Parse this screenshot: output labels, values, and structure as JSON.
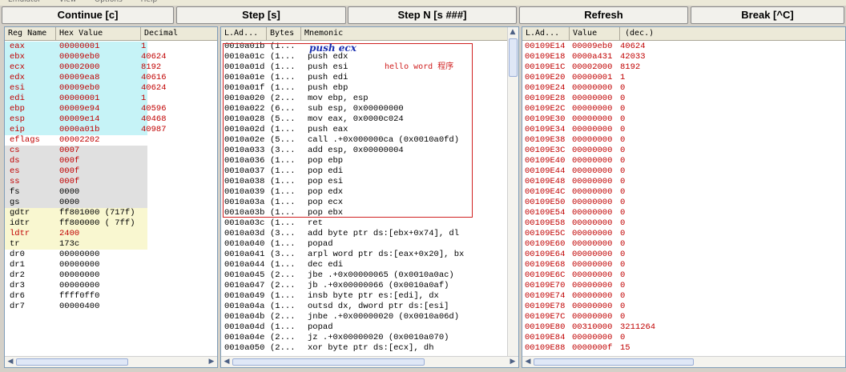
{
  "menubar": [
    "Emulator",
    "View",
    "Options",
    "Help"
  ],
  "toolbar": {
    "continue": "Continue [c]",
    "step": "Step [s]",
    "stepn": "Step N [s ###]",
    "refresh": "Refresh",
    "break": "Break [^C]"
  },
  "regs": {
    "headers": [
      "Reg Name",
      "Hex Value",
      "Decimal"
    ],
    "rows": [
      {
        "name": "eax",
        "hex": "00000001",
        "dec": "1",
        "grp": "reg",
        "color": "red"
      },
      {
        "name": "ebx",
        "hex": "00009eb0",
        "dec": "40624",
        "grp": "reg",
        "color": "red"
      },
      {
        "name": "ecx",
        "hex": "00002000",
        "dec": "8192",
        "grp": "reg",
        "color": "red"
      },
      {
        "name": "edx",
        "hex": "00009ea8",
        "dec": "40616",
        "grp": "reg",
        "color": "red"
      },
      {
        "name": "esi",
        "hex": "00009eb0",
        "dec": "40624",
        "grp": "reg",
        "color": "red"
      },
      {
        "name": "edi",
        "hex": "00000001",
        "dec": "1",
        "grp": "reg",
        "color": "red"
      },
      {
        "name": "ebp",
        "hex": "00009e94",
        "dec": "40596",
        "grp": "reg",
        "color": "red"
      },
      {
        "name": "esp",
        "hex": "00009e14",
        "dec": "40468",
        "grp": "reg",
        "color": "red"
      },
      {
        "name": "eip",
        "hex": "0000a01b",
        "dec": "40987",
        "grp": "reg",
        "color": "red"
      },
      {
        "name": "eflags",
        "hex": "00002202",
        "dec": "",
        "grp": "dr",
        "color": "red"
      },
      {
        "name": "cs",
        "hex": "0007",
        "dec": "",
        "grp": "seg",
        "color": "red"
      },
      {
        "name": "ds",
        "hex": "000f",
        "dec": "",
        "grp": "seg",
        "color": "red"
      },
      {
        "name": "es",
        "hex": "000f",
        "dec": "",
        "grp": "seg",
        "color": "red"
      },
      {
        "name": "ss",
        "hex": "000f",
        "dec": "",
        "grp": "seg",
        "color": "red"
      },
      {
        "name": "fs",
        "hex": "0000",
        "dec": "",
        "grp": "seg",
        "color": "black"
      },
      {
        "name": "gs",
        "hex": "0000",
        "dec": "",
        "grp": "seg",
        "color": "black"
      },
      {
        "name": "gdtr",
        "hex": "ff801000 (717f)",
        "dec": "",
        "grp": "desc",
        "color": "black"
      },
      {
        "name": "idtr",
        "hex": "ff800000 ( 7ff)",
        "dec": "",
        "grp": "desc",
        "color": "black"
      },
      {
        "name": "ldtr",
        "hex": "2400",
        "dec": "",
        "grp": "desc",
        "color": "red"
      },
      {
        "name": "tr",
        "hex": "173c",
        "dec": "",
        "grp": "desc",
        "color": "black"
      },
      {
        "name": "dr0",
        "hex": "00000000",
        "dec": "",
        "grp": "dr",
        "color": "black"
      },
      {
        "name": "dr1",
        "hex": "00000000",
        "dec": "",
        "grp": "dr",
        "color": "black"
      },
      {
        "name": "dr2",
        "hex": "00000000",
        "dec": "",
        "grp": "dr",
        "color": "black"
      },
      {
        "name": "dr3",
        "hex": "00000000",
        "dec": "",
        "grp": "dr",
        "color": "black"
      },
      {
        "name": "dr6",
        "hex": "ffff0ff0",
        "dec": "",
        "grp": "dr",
        "color": "black"
      },
      {
        "name": "dr7",
        "hex": "00000400",
        "dec": "",
        "grp": "dr",
        "color": "black"
      }
    ]
  },
  "disasm": {
    "headers": [
      "L.Ad...",
      "Bytes",
      "Mnemonic"
    ],
    "rows": [
      {
        "addr": "0010a01b",
        "bytes": "(1...",
        "mn": ""
      },
      {
        "addr": "0010a01c",
        "bytes": "(1...",
        "mn": "push edx"
      },
      {
        "addr": "0010a01d",
        "bytes": "(1...",
        "mn": "push esi"
      },
      {
        "addr": "0010a01e",
        "bytes": "(1...",
        "mn": "push edi"
      },
      {
        "addr": "0010a01f",
        "bytes": "(1...",
        "mn": "push ebp"
      },
      {
        "addr": "0010a020",
        "bytes": "(2...",
        "mn": "mov ebp, esp"
      },
      {
        "addr": "0010a022",
        "bytes": "(6...",
        "mn": "sub esp, 0x00000000"
      },
      {
        "addr": "0010a028",
        "bytes": "(5...",
        "mn": "mov eax, 0x0000c024"
      },
      {
        "addr": "0010a02d",
        "bytes": "(1...",
        "mn": "push eax"
      },
      {
        "addr": "0010a02e",
        "bytes": "(5...",
        "mn": "call .+0x000000ca  (0x0010a0fd)"
      },
      {
        "addr": "0010a033",
        "bytes": "(3...",
        "mn": "add esp, 0x00000004"
      },
      {
        "addr": "0010a036",
        "bytes": "(1...",
        "mn": "pop ebp"
      },
      {
        "addr": "0010a037",
        "bytes": "(1...",
        "mn": "pop edi"
      },
      {
        "addr": "0010a038",
        "bytes": "(1...",
        "mn": "pop esi"
      },
      {
        "addr": "0010a039",
        "bytes": "(1...",
        "mn": "pop edx"
      },
      {
        "addr": "0010a03a",
        "bytes": "(1...",
        "mn": "pop ecx"
      },
      {
        "addr": "0010a03b",
        "bytes": "(1...",
        "mn": "pop ebx"
      },
      {
        "addr": "0010a03c",
        "bytes": "(1...",
        "mn": "ret"
      },
      {
        "addr": "0010a03d",
        "bytes": "(3...",
        "mn": "add byte ptr ds:[ebx+0x74], dl"
      },
      {
        "addr": "0010a040",
        "bytes": "(1...",
        "mn": "popad"
      },
      {
        "addr": "0010a041",
        "bytes": "(3...",
        "mn": "arpl word ptr ds:[eax+0x20], bx"
      },
      {
        "addr": "0010a044",
        "bytes": "(1...",
        "mn": "dec edi"
      },
      {
        "addr": "0010a045",
        "bytes": "(2...",
        "mn": "jbe .+0x00000065  (0x0010a0ac)"
      },
      {
        "addr": "0010a047",
        "bytes": "(2...",
        "mn": "jb .+0x00000066  (0x0010a0af)"
      },
      {
        "addr": "0010a049",
        "bytes": "(1...",
        "mn": "insb byte ptr es:[edi], dx"
      },
      {
        "addr": "0010a04a",
        "bytes": "(1...",
        "mn": "outsd dx, dword ptr ds:[esi]"
      },
      {
        "addr": "0010a04b",
        "bytes": "(2...",
        "mn": "jnbe .+0x00000020  (0x0010a06d)"
      },
      {
        "addr": "0010a04d",
        "bytes": "(1...",
        "mn": "popad"
      },
      {
        "addr": "0010a04e",
        "bytes": "(2...",
        "mn": "jz .+0x00000020  (0x0010a070)"
      },
      {
        "addr": "0010a050",
        "bytes": "(2...",
        "mn": "xor byte ptr ds:[ecx], dh"
      }
    ],
    "handwritten_note": "push ecx",
    "annotation": "hello word 程序"
  },
  "stack": {
    "headers": [
      "L.Ad...",
      "Value",
      "(dec.)"
    ],
    "rows": [
      {
        "addr": "00109E14",
        "val": "00009eb0",
        "dec": "40624"
      },
      {
        "addr": "00109E18",
        "val": "0000a431",
        "dec": "42033"
      },
      {
        "addr": "00109E1C",
        "val": "00002000",
        "dec": "8192"
      },
      {
        "addr": "00109E20",
        "val": "00000001",
        "dec": "1"
      },
      {
        "addr": "00109E24",
        "val": "00000000",
        "dec": "0"
      },
      {
        "addr": "00109E28",
        "val": "00000000",
        "dec": "0"
      },
      {
        "addr": "00109E2C",
        "val": "00000000",
        "dec": "0"
      },
      {
        "addr": "00109E30",
        "val": "00000000",
        "dec": "0"
      },
      {
        "addr": "00109E34",
        "val": "00000000",
        "dec": "0"
      },
      {
        "addr": "00109E38",
        "val": "00000000",
        "dec": "0"
      },
      {
        "addr": "00109E3C",
        "val": "00000000",
        "dec": "0"
      },
      {
        "addr": "00109E40",
        "val": "00000000",
        "dec": "0"
      },
      {
        "addr": "00109E44",
        "val": "00000000",
        "dec": "0"
      },
      {
        "addr": "00109E48",
        "val": "00000000",
        "dec": "0"
      },
      {
        "addr": "00109E4C",
        "val": "00000000",
        "dec": "0"
      },
      {
        "addr": "00109E50",
        "val": "00000000",
        "dec": "0"
      },
      {
        "addr": "00109E54",
        "val": "00000000",
        "dec": "0"
      },
      {
        "addr": "00109E58",
        "val": "00000000",
        "dec": "0"
      },
      {
        "addr": "00109E5C",
        "val": "00000000",
        "dec": "0"
      },
      {
        "addr": "00109E60",
        "val": "00000000",
        "dec": "0"
      },
      {
        "addr": "00109E64",
        "val": "00000000",
        "dec": "0"
      },
      {
        "addr": "00109E68",
        "val": "00000000",
        "dec": "0"
      },
      {
        "addr": "00109E6C",
        "val": "00000000",
        "dec": "0"
      },
      {
        "addr": "00109E70",
        "val": "00000000",
        "dec": "0"
      },
      {
        "addr": "00109E74",
        "val": "00000000",
        "dec": "0"
      },
      {
        "addr": "00109E78",
        "val": "00000000",
        "dec": "0"
      },
      {
        "addr": "00109E7C",
        "val": "00000000",
        "dec": "0"
      },
      {
        "addr": "00109E80",
        "val": "00310000",
        "dec": "3211264"
      },
      {
        "addr": "00109E84",
        "val": "00000000",
        "dec": "0"
      },
      {
        "addr": "00109E88",
        "val": "0000000f",
        "dec": "15"
      }
    ]
  },
  "colors": {
    "red_text": "#c00000",
    "reg_bg": "#c6f3f7",
    "seg_bg": "#e0e0e0",
    "desc_bg": "#f9f7d0",
    "annotation": "#d02020"
  }
}
